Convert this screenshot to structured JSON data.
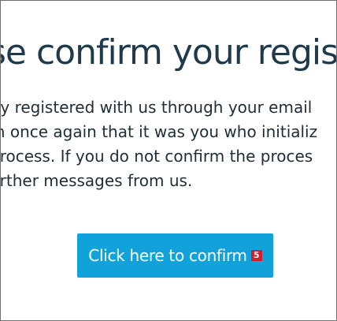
{
  "heading": "se confirm your registr",
  "body": {
    "lines": [
      "tly registered with us through your email",
      "m once again that it was you who initializ",
      "process. If you do not confirm the proces",
      "urther messages from us."
    ]
  },
  "confirm_button": {
    "label": "Click here to confirm",
    "badge": "5",
    "background": "#12a2db"
  },
  "colors": {
    "heading": "#1e3a4c",
    "body_text": "#1e2d38",
    "badge": "#d21f2f"
  }
}
